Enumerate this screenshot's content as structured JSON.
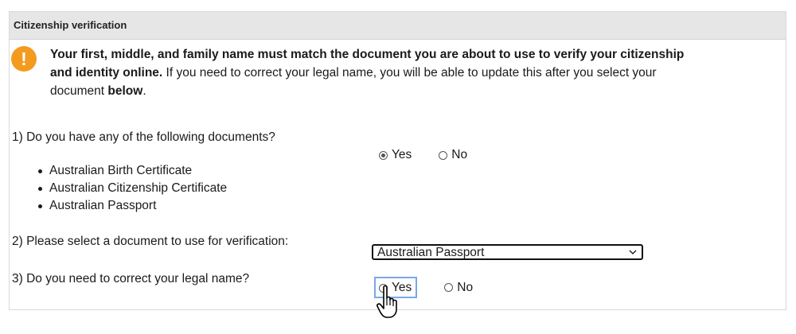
{
  "panel": {
    "title": "Citizenship verification"
  },
  "alert": {
    "icon": "exclamation-icon",
    "icon_glyph": "!",
    "bold_text": "Your first, middle, and family name must match the document you are about to use to verify your citizenship and identity online.",
    "text_1": " If you need to correct your legal name, you will be able to update this after you select your document ",
    "bold_text_2": "below",
    "text_2": "."
  },
  "question1": {
    "label": "1) Do you have any of the following documents?",
    "documents": [
      "Australian Birth Certificate",
      "Australian Citizenship Certificate",
      "Australian Passport"
    ],
    "options": {
      "yes": "Yes",
      "no": "No"
    },
    "selected": "Yes"
  },
  "question2": {
    "label": "2) Please select a document to use for verification:",
    "selected_value": "Australian Passport"
  },
  "question3": {
    "label": "3) Do you need to correct your legal name?",
    "options": {
      "yes": "Yes",
      "no": "No"
    },
    "focused": "Yes"
  },
  "cursor": {
    "icon": "hand-pointer-icon"
  }
}
